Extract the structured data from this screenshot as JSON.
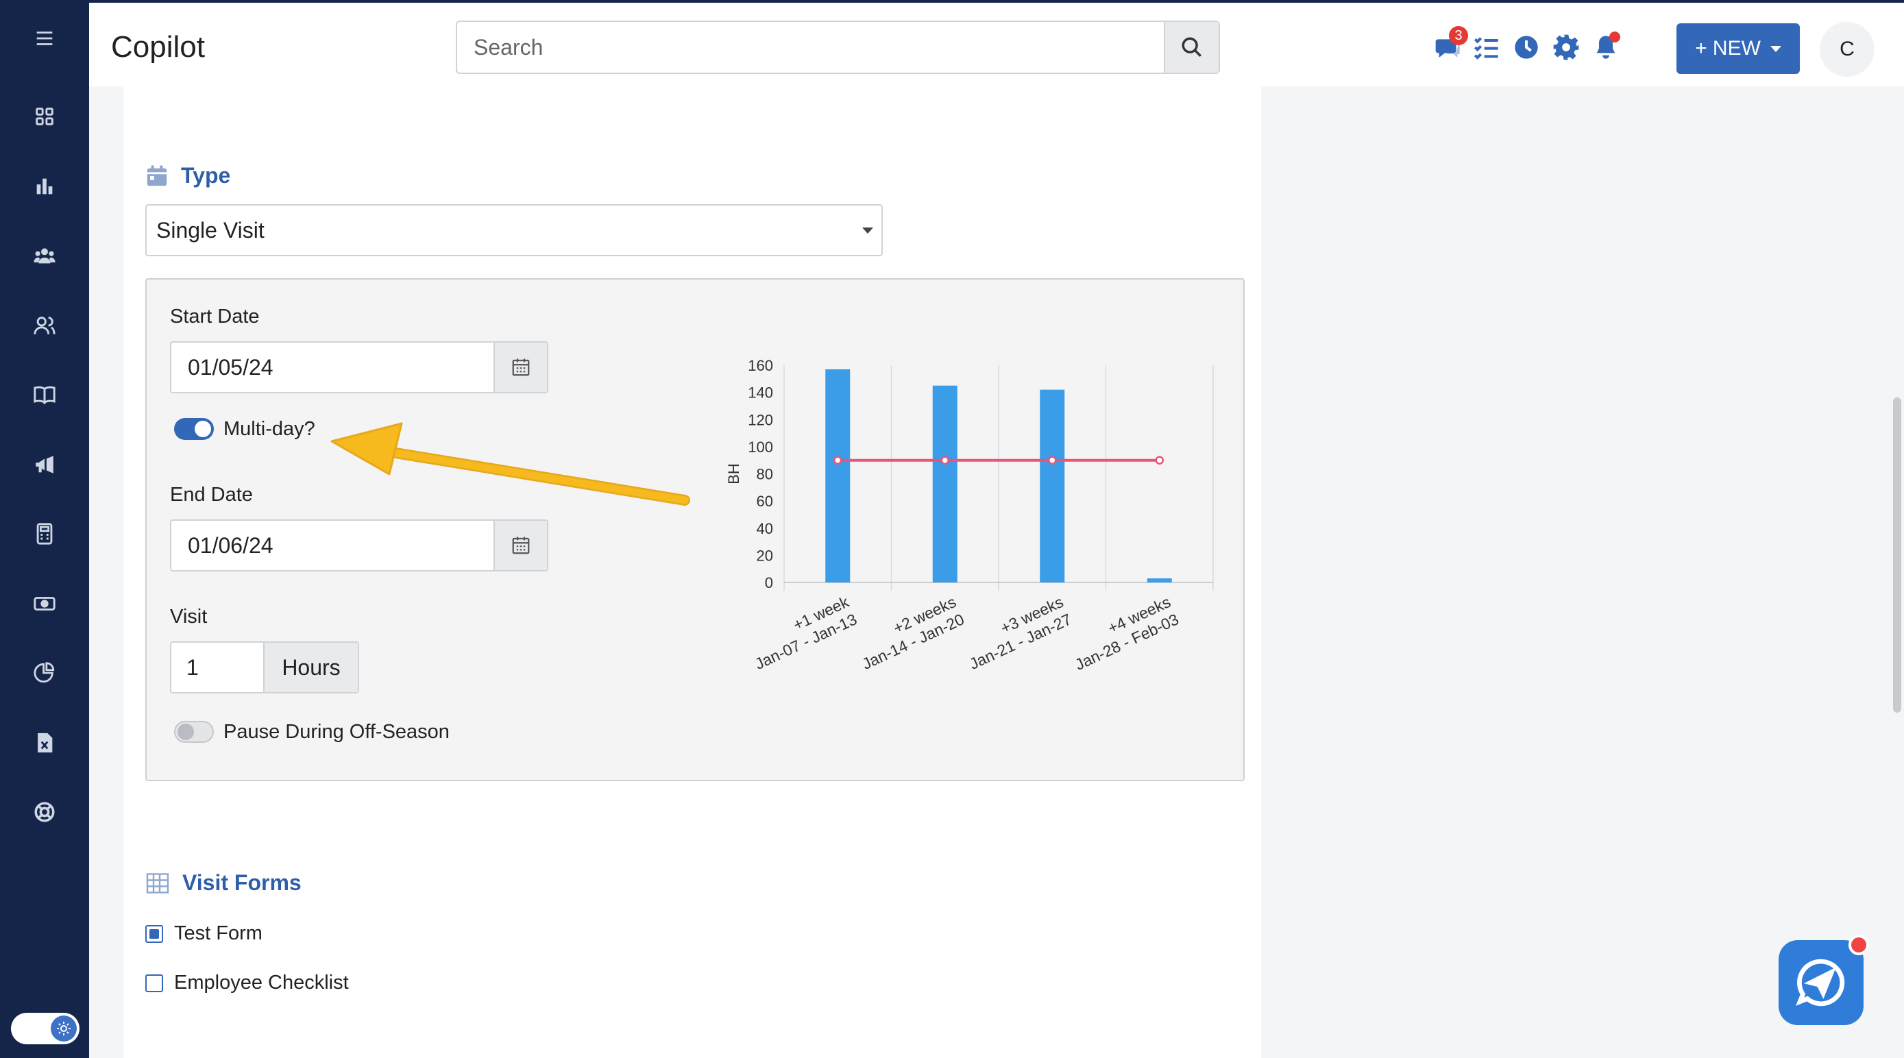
{
  "app": {
    "title": "Copilot"
  },
  "search": {
    "placeholder": "Search"
  },
  "header": {
    "messages_badge": "3",
    "new_button": "+ NEW",
    "avatar_initial": "C"
  },
  "sidebar": {
    "items": [
      "menu-icon",
      "dashboard-icon",
      "reports-icon",
      "crew-icon",
      "clients-icon",
      "catalog-icon",
      "marketing-icon",
      "estimates-icon",
      "payments-icon",
      "analytics-icon",
      "export-icon",
      "help-icon"
    ]
  },
  "type_section": {
    "title": "Type",
    "selected": "Single Visit"
  },
  "schedule": {
    "start_label": "Start Date",
    "start_value": "01/05/24",
    "multiday_label": "Multi-day?",
    "end_label": "End Date",
    "end_value": "01/06/24",
    "visit_label": "Visit",
    "visit_value": "1",
    "visit_unit": "Hours",
    "pause_label": "Pause During Off-Season"
  },
  "chart_data": {
    "type": "bar",
    "ylabel": "BH",
    "ylim": [
      0,
      160
    ],
    "yticks": [
      0,
      20,
      40,
      60,
      80,
      100,
      120,
      140,
      160
    ],
    "categories": [
      [
        "+1 week",
        "Jan-07 - Jan-13"
      ],
      [
        "+2 weeks",
        "Jan-14 - Jan-20"
      ],
      [
        "+3 weeks",
        "Jan-21 - Jan-27"
      ],
      [
        "+4 weeks",
        "Jan-28 - Feb-03"
      ]
    ],
    "series": [
      {
        "type": "bar",
        "color": "#3b9ce8",
        "values": [
          157,
          145,
          142,
          3
        ]
      },
      {
        "type": "line",
        "color": "#e8557a",
        "values": [
          90,
          90,
          90,
          90
        ]
      }
    ],
    "grid": "vertical"
  },
  "visit_forms": {
    "title": "Visit Forms",
    "items": [
      {
        "label": "Test Form",
        "checked": true
      },
      {
        "label": "Employee Checklist",
        "checked": false
      }
    ]
  }
}
